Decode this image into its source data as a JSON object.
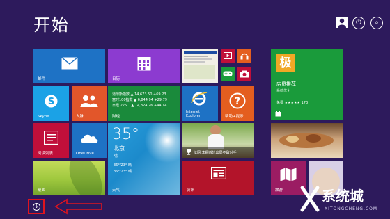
{
  "start": {
    "title": "开始"
  },
  "header": {
    "user_icon": "user-icon",
    "power_icon": "power-icon",
    "search_icon": "search-icon"
  },
  "tiles": {
    "mail": {
      "label": "邮件",
      "icon": "mail-icon",
      "color": "#1e72c5"
    },
    "calendar": {
      "label": "日历",
      "icon": "calendar-icon",
      "color": "#8c3bd0"
    },
    "photos": {
      "label": "",
      "icon": "photo-thumbnail"
    },
    "video": {
      "icon": "video-icon",
      "color": "#c00f3a"
    },
    "music": {
      "icon": "headphones-icon",
      "color": "#e45e1f"
    },
    "games": {
      "icon": "gamepad-icon",
      "color": "#1a9b3b"
    },
    "camera": {
      "icon": "camera-icon",
      "color": "#c00f3a"
    },
    "skype": {
      "label": "Skype",
      "icon": "skype-icon",
      "color": "#1ba2e6"
    },
    "people": {
      "label": "人脉",
      "icon": "people-icon",
      "color": "#e2562a"
    },
    "finance": {
      "label": "财经",
      "color": "#1a8a3b",
      "rows": [
        "道琼斯指数 ▲ 14,673.50 +69.23",
        "富时100指数 ▲ 6,844.94 +29.79",
        "日经 225... ▲ 14,824.26 +44.14"
      ]
    },
    "ie": {
      "label": "Internet Explorer",
      "icon": "ie-icon",
      "color": "#1e72c5"
    },
    "help": {
      "label": "帮助+提示",
      "icon": "help-icon",
      "color": "#e45e1f"
    },
    "store": {
      "logo": "极",
      "name": "店员推荐",
      "category": "系统优化",
      "price": "免费 ★★★★★ 173",
      "icon": "store-bag-icon",
      "color": "#1a9b3b"
    },
    "reader": {
      "label": "阅读列表",
      "icon": "reader-icon",
      "color": "#c00f3a"
    },
    "onedrive": {
      "label": "OneDrive",
      "icon": "cloud-icon",
      "color": "#1e72c5"
    },
    "weather": {
      "temp": "35°",
      "city": "北京",
      "cond": "晴",
      "range1": "36°/23° 晴",
      "range2": "36°/23° 晴",
      "label": "天气",
      "color": "#1c94d2"
    },
    "sports": {
      "label": "体育",
      "icon": "trophy-icon",
      "caption": "法网:李娜首轮出局不敌对手"
    },
    "food": {
      "label": "",
      "icon": "food-photo"
    },
    "desktop": {
      "label": "桌面"
    },
    "news": {
      "label": "资讯",
      "icon": "news-icon",
      "color": "#b3142a"
    },
    "travel": {
      "label": "旅游",
      "icon": "map-icon",
      "color": "#9b1c63"
    }
  },
  "footer": {
    "apps_arrow": "↓",
    "watermark": "系统城",
    "watermark_sub": "XITONGCHENG.COM"
  }
}
